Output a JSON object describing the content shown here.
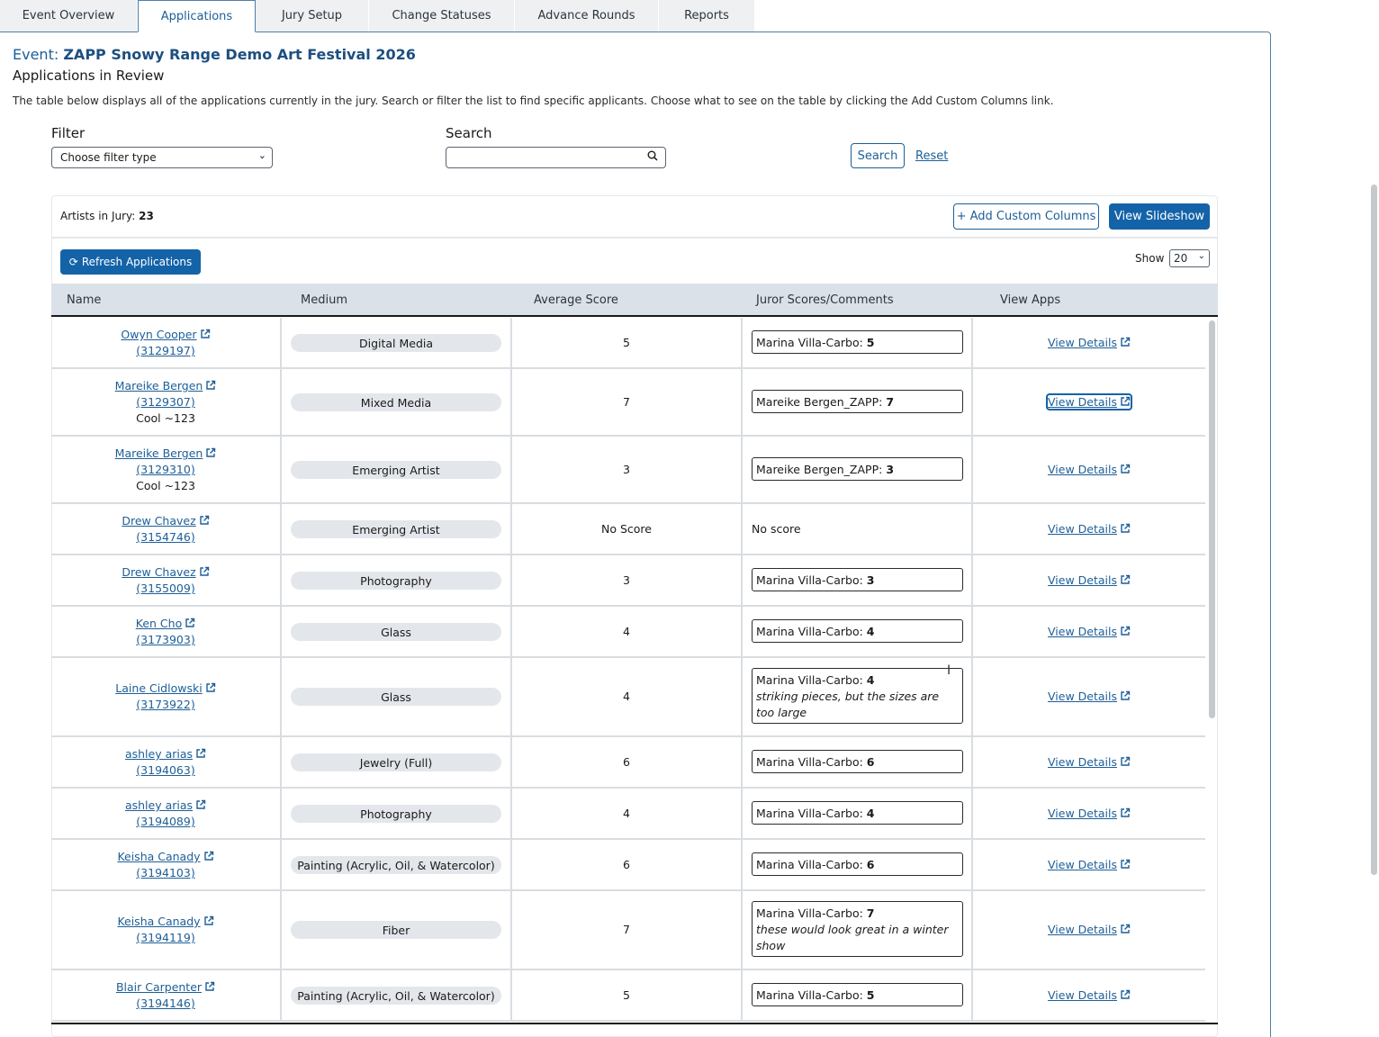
{
  "tabs": [
    "Event Overview",
    "Applications",
    "Jury Setup",
    "Change Statuses",
    "Advance Rounds",
    "Reports"
  ],
  "event": {
    "label": "Event:",
    "name": "ZAPP Snowy Range Demo Art Festival 2026"
  },
  "subtitle": "Applications in Review",
  "description": "The table below displays all of the applications currently in the jury. Search or filter the list to find specific applicants. Choose what to see on the table by clicking the Add Custom Columns link.",
  "filter": {
    "label": "Filter",
    "selected": "Choose filter type"
  },
  "search": {
    "label": "Search",
    "value": "",
    "button": "Search",
    "reset": "Reset"
  },
  "card": {
    "artists_label": "Artists in Jury:",
    "artists_count": "23",
    "add_columns": "+ Add Custom Columns",
    "slideshow": "View Slideshow",
    "refresh": "Refresh Applications",
    "show_label": "Show",
    "show_value": "20"
  },
  "columns": [
    "Name",
    "Medium",
    "Average Score",
    "Juror Scores/Comments",
    "View Apps"
  ],
  "rows": [
    {
      "name": "Owyn Cooper",
      "id": "(3129197)",
      "note": "",
      "medium": "Digital Media",
      "avg": "5",
      "juror": "Marina Villa-Carbo:",
      "score": "5",
      "comment": "",
      "view": "View Details"
    },
    {
      "name": "Mareike Bergen",
      "id": "(3129307)",
      "note": "Cool ~123",
      "medium": "Mixed Media",
      "avg": "7",
      "juror": "Mareike Bergen_ZAPP:",
      "score": "7",
      "comment": "",
      "view": "View Details"
    },
    {
      "name": "Mareike Bergen",
      "id": "(3129310)",
      "note": "Cool ~123",
      "medium": "Emerging Artist",
      "avg": "3",
      "juror": "Mareike Bergen_ZAPP:",
      "score": "3",
      "comment": "",
      "view": "View Details"
    },
    {
      "name": "Drew Chavez",
      "id": "(3154746)",
      "note": "",
      "medium": "Emerging Artist",
      "avg": "No Score",
      "juror": "",
      "score": "",
      "comment": "",
      "noscore": "No score",
      "view": "View Details"
    },
    {
      "name": "Drew Chavez",
      "id": "(3155009)",
      "note": "",
      "medium": "Photography",
      "avg": "3",
      "juror": "Marina Villa-Carbo:",
      "score": "3",
      "comment": "",
      "view": "View Details"
    },
    {
      "name": "Ken Cho",
      "id": "(3173903)",
      "note": "",
      "medium": "Glass",
      "avg": "4",
      "juror": "Marina Villa-Carbo:",
      "score": "4",
      "comment": "",
      "view": "View Details"
    },
    {
      "name": "Laine Cidlowski",
      "id": "(3173922)",
      "note": "",
      "medium": "Glass",
      "avg": "4",
      "juror": "Marina Villa-Carbo:",
      "score": "4",
      "comment": "striking pieces, but the sizes are too large",
      "view": "View Details"
    },
    {
      "name": "ashley arias",
      "id": "(3194063)",
      "note": "",
      "medium": "Jewelry (Full)",
      "avg": "6",
      "juror": "Marina Villa-Carbo:",
      "score": "6",
      "comment": "",
      "view": "View Details"
    },
    {
      "name": "ashley arias",
      "id": "(3194089)",
      "note": "",
      "medium": "Photography",
      "avg": "4",
      "juror": "Marina Villa-Carbo:",
      "score": "4",
      "comment": "",
      "view": "View Details"
    },
    {
      "name": "Keisha Canady",
      "id": "(3194103)",
      "note": "",
      "medium": "Painting (Acrylic, Oil, & Watercolor)",
      "avg": "6",
      "juror": "Marina Villa-Carbo:",
      "score": "6",
      "comment": "",
      "view": "View Details"
    },
    {
      "name": "Keisha Canady",
      "id": "(3194119)",
      "note": "",
      "medium": "Fiber",
      "avg": "7",
      "juror": "Marina Villa-Carbo:",
      "score": "7",
      "comment": "these would look great in a winter show",
      "view": "View Details"
    },
    {
      "name": "Blair Carpenter",
      "id": "(3194146)",
      "note": "",
      "medium": "Painting (Acrylic, Oil, & Watercolor)",
      "avg": "5",
      "juror": "Marina Villa-Carbo:",
      "score": "5",
      "comment": "",
      "view": "View Details"
    }
  ]
}
